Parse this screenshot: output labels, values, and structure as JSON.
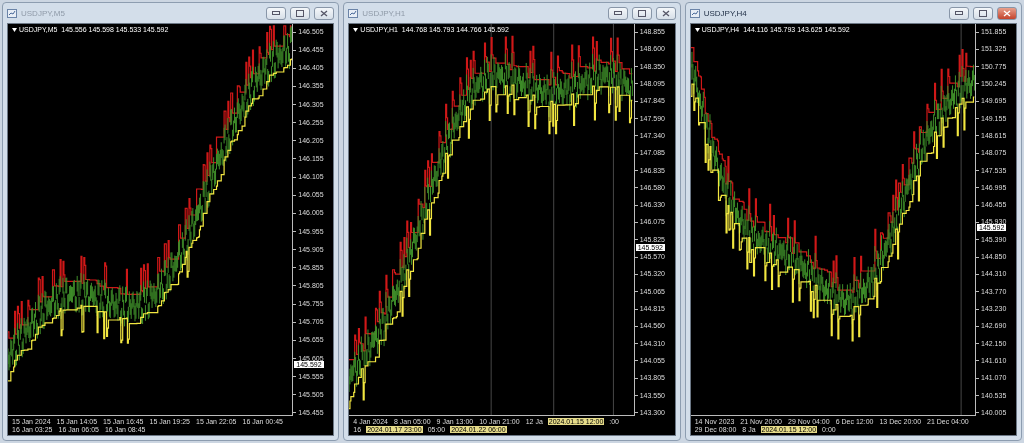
{
  "windows": [
    {
      "title": "USDJPY,M5",
      "active": false,
      "info": "USDJPY,M5  145.556 145.598 145.533 145.592",
      "current_price": "145.592",
      "price_labels": [
        "146.505",
        "146.455",
        "146.405",
        "146.355",
        "146.305",
        "146.255",
        "146.205",
        "146.155",
        "146.105",
        "146.055",
        "146.005",
        "145.955",
        "145.905",
        "145.855",
        "145.805",
        "145.755",
        "145.705",
        "145.655",
        "145.605",
        "145.555",
        "145.505",
        "145.455"
      ],
      "time_labels": [
        {
          "text": "15 Jan 2024",
          "kind": "label"
        },
        {
          "text": "15 Jan 14:05",
          "kind": "label"
        },
        {
          "text": "15 Jan 16:45",
          "kind": "label"
        },
        {
          "text": "15 Jan 19:25",
          "kind": "label"
        },
        {
          "text": "15 Jan 22:05",
          "kind": "label"
        },
        {
          "text": "16 Jan 00:45",
          "kind": "label"
        },
        {
          "text": "16 Jan 03:25",
          "kind": "label"
        },
        {
          "text": "16 Jan 06:05",
          "kind": "label"
        },
        {
          "text": "16 Jan 08:45",
          "kind": "label"
        }
      ]
    },
    {
      "title": "USDJPY,H1",
      "active": false,
      "info": "USDJPY,H1  144.768 145.793 144.766 145.592",
      "current_price": "145.592",
      "price_labels": [
        "148.855",
        "148.600",
        "148.350",
        "148.095",
        "147.845",
        "147.590",
        "147.340",
        "147.085",
        "146.835",
        "146.580",
        "146.330",
        "146.075",
        "145.825",
        "145.570",
        "145.320",
        "145.065",
        "144.815",
        "144.560",
        "144.310",
        "144.055",
        "143.805",
        "143.550",
        "143.300"
      ],
      "time_labels": [
        {
          "text": "4 Jan 2024",
          "kind": "label"
        },
        {
          "text": "8 Jan 05:00",
          "kind": "label"
        },
        {
          "text": "9 Jan 13:00",
          "kind": "label"
        },
        {
          "text": "10 Jan 21:00",
          "kind": "label"
        },
        {
          "text": "12 Ja",
          "kind": "label"
        },
        {
          "text": "2024.01.15 12:00",
          "kind": "highlight"
        },
        {
          "text": ":00",
          "kind": "label"
        },
        {
          "text": "16",
          "kind": "label"
        },
        {
          "text": "2024.01.17 23:00",
          "kind": "highlight"
        },
        {
          "text": "05:00",
          "kind": "label"
        },
        {
          "text": "2024.01.22 06:00",
          "kind": "highlight"
        }
      ]
    },
    {
      "title": "USDJPY,H4",
      "active": true,
      "info": "USDJPY,H4  144.116 145.793 143.625 145.592",
      "current_price": "145.592",
      "price_labels": [
        "151.855",
        "151.325",
        "150.775",
        "150.245",
        "149.695",
        "149.155",
        "148.615",
        "148.075",
        "147.535",
        "146.995",
        "146.455",
        "145.930",
        "145.390",
        "144.850",
        "144.310",
        "143.770",
        "143.230",
        "142.690",
        "142.150",
        "141.610",
        "141.070",
        "140.535",
        "140.005"
      ],
      "time_labels": [
        {
          "text": "14 Nov 2023",
          "kind": "label"
        },
        {
          "text": "21 Nov 20:00",
          "kind": "label"
        },
        {
          "text": "29 Nov 04:00",
          "kind": "label"
        },
        {
          "text": "6 Dec 12:00",
          "kind": "label"
        },
        {
          "text": "13 Dec 20:00",
          "kind": "label"
        },
        {
          "text": "21 Dec 04:00",
          "kind": "label"
        },
        {
          "text": "29 Dec 08:00",
          "kind": "label"
        },
        {
          "text": "8 Ja",
          "kind": "label"
        },
        {
          "text": "2024.01.15 12:00",
          "kind": "highlight"
        },
        {
          "text": "0:00",
          "kind": "label"
        }
      ]
    }
  ]
}
